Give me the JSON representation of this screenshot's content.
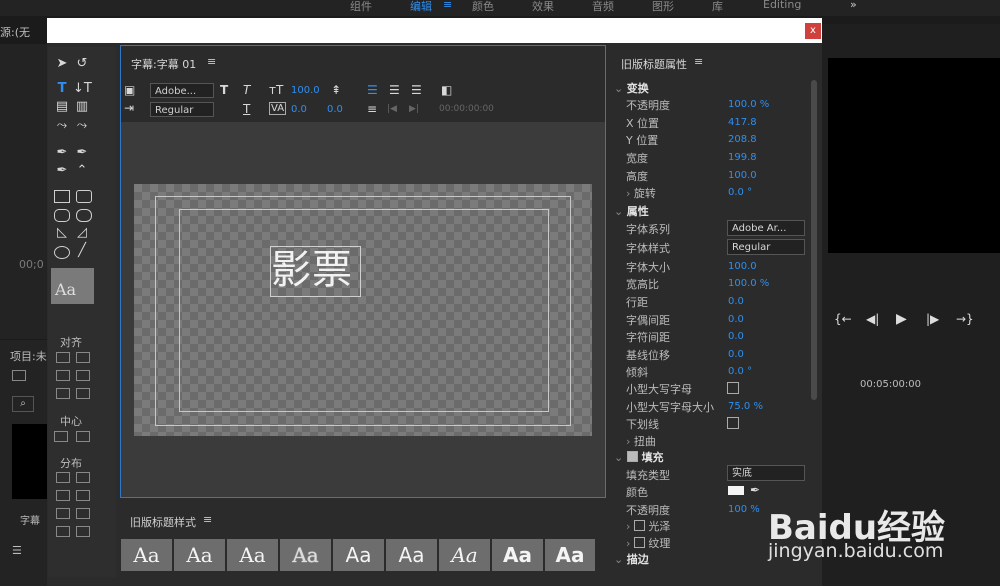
{
  "app": {
    "workspace_tabs": [
      "组件",
      "编辑",
      "颜色",
      "效果",
      "音频",
      "图形",
      "库",
      "Editing"
    ],
    "active_tab_index": 1,
    "source_label": "源:(无",
    "timecode_left": "00;0",
    "timeline_time": "00:05:00:00",
    "project_label": "项目:未",
    "caption_thumb_label": "字幕",
    "accent_color": "#2f8ff0"
  },
  "dialog": {
    "close_label": "x",
    "editor": {
      "title": "字幕:字幕 01",
      "menu_icon": "≡",
      "font_family": "Adobe...",
      "font_style": "Regular",
      "font_size": "100.0",
      "kerning": "0.0",
      "leading": "0.0",
      "timecode": "00:00:00:00",
      "text_content": "影票"
    },
    "tools": {
      "align_label": "对齐",
      "center_label": "中心",
      "distribute_label": "分布",
      "preview_label": "Aa"
    },
    "styles": {
      "title": "旧版标题样式",
      "swatches": [
        "Aa",
        "Aa",
        "Aa",
        "Aa",
        "Aa",
        "Aa",
        "Aa",
        "Aa",
        "Aa"
      ]
    },
    "properties": {
      "title": "旧版标题属性",
      "transform_label": "变换",
      "rows_transform": [
        {
          "label": "不透明度",
          "value": "100.0 %"
        },
        {
          "label": "X 位置",
          "value": "417.8"
        },
        {
          "label": "Y 位置",
          "value": "208.8"
        },
        {
          "label": "宽度",
          "value": "199.8"
        },
        {
          "label": "高度",
          "value": "100.0"
        },
        {
          "label": "旋转",
          "value": "0.0 °"
        }
      ],
      "attributes_label": "属性",
      "font_family_label": "字体系列",
      "font_family_value": "Adobe Ar...",
      "font_style_label": "字体样式",
      "font_style_value": "Regular",
      "rows_attr": [
        {
          "label": "字体大小",
          "value": "100.0"
        },
        {
          "label": "宽高比",
          "value": "100.0 %"
        },
        {
          "label": "行距",
          "value": "0.0"
        },
        {
          "label": "字偶间距",
          "value": "0.0"
        },
        {
          "label": "字符间距",
          "value": "0.0"
        },
        {
          "label": "基线位移",
          "value": "0.0"
        },
        {
          "label": "倾斜",
          "value": "0.0 °"
        }
      ],
      "small_caps_label": "小型大写字母",
      "small_caps_size_label": "小型大写字母大小",
      "small_caps_size_value": "75.0 %",
      "underline_label": "下划线",
      "distort_label": "扭曲",
      "fill_label": "填充",
      "fill_type_label": "填充类型",
      "fill_type_value": "实底",
      "color_label": "颜色",
      "fill_opacity_label": "不透明度",
      "fill_opacity_value": "100 %",
      "sheen_label": "光泽",
      "texture_label": "纹理",
      "stroke_label": "描边"
    }
  },
  "watermark": {
    "line1": "Baidu经验",
    "line2": "jingyan.baidu.com"
  }
}
